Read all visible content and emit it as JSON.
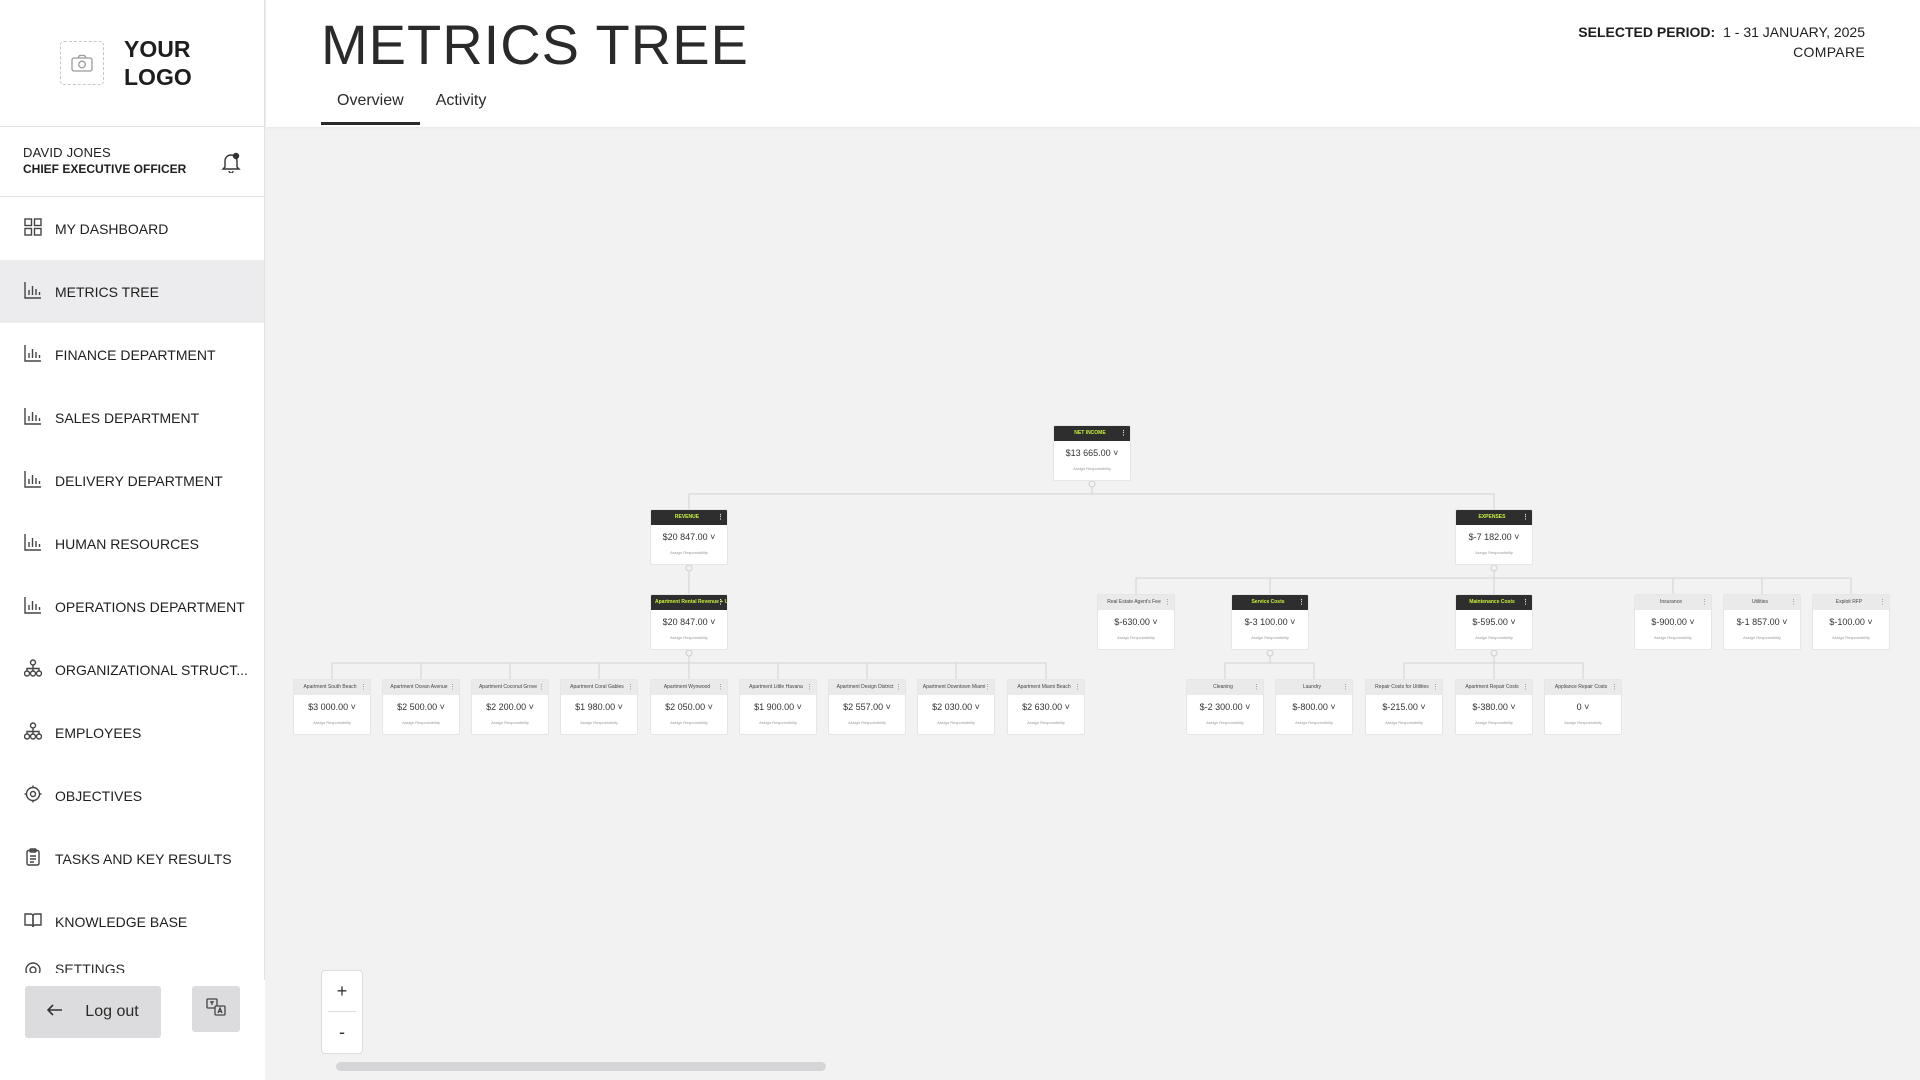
{
  "logo": {
    "text": "YOUR LOGO"
  },
  "user": {
    "name": "DAVID JONES",
    "role": "CHIEF EXECUTIVE OFFICER"
  },
  "nav": [
    {
      "label": "MY DASHBOARD",
      "icon": "grid-icon"
    },
    {
      "label": "METRICS TREE",
      "icon": "bar-chart-icon",
      "active": true
    },
    {
      "label": "FINANCE DEPARTMENT",
      "icon": "bar-chart-icon"
    },
    {
      "label": "SALES DEPARTMENT",
      "icon": "bar-chart-icon"
    },
    {
      "label": "DELIVERY DEPARTMENT",
      "icon": "bar-chart-icon"
    },
    {
      "label": "HUMAN RESOURCES",
      "icon": "bar-chart-icon"
    },
    {
      "label": "OPERATIONS DEPARTMENT",
      "icon": "bar-chart-icon"
    },
    {
      "label": "ORGANIZATIONAL STRUCT...",
      "icon": "org-chart-icon"
    },
    {
      "label": "EMPLOYEES",
      "icon": "org-chart-icon"
    },
    {
      "label": "OBJECTIVES",
      "icon": "target-icon"
    },
    {
      "label": "TASKS AND KEY RESULTS",
      "icon": "clipboard-icon"
    },
    {
      "label": "KNOWLEDGE BASE",
      "icon": "book-icon"
    },
    {
      "label": "SETTINGS",
      "icon": "gear-icon"
    }
  ],
  "logout": {
    "label": "Log out"
  },
  "header": {
    "title": "METRICS TREE",
    "tabs": [
      "Overview",
      "Activity"
    ],
    "period_label": "SELECTED PERIOD:",
    "period_value": "1 - 31 JANUARY, 2025",
    "compare": "COMPARE"
  },
  "zoom": {
    "in": "+",
    "out": "-"
  },
  "tree": {
    "subtitle": "Assign Responsibility",
    "nodes": [
      {
        "title": "NET INCOME",
        "value": "$13 665.00",
        "dark": true
      },
      {
        "title": "REVENUE",
        "value": "$20 847.00",
        "dark": true
      },
      {
        "title": "EXPENSES",
        "value": "$-7 182.00",
        "dark": true
      },
      {
        "title": "Apartment Rental Revenue + Utilitie...",
        "value": "$20 847.00",
        "dark": true
      },
      {
        "title": "Real Estate Agent's Fee",
        "value": "$-630.00"
      },
      {
        "title": "Service Costs",
        "value": "$-3 100.00",
        "dark": true
      },
      {
        "title": "Maintenance Costs",
        "value": "$-595.00",
        "dark": true
      },
      {
        "title": "Insurance",
        "value": "$-900.00"
      },
      {
        "title": "Utilities",
        "value": "$-1 857.00"
      },
      {
        "title": "Exploit RFP",
        "value": "$-100.00"
      },
      {
        "title": "Apartment South Beach",
        "value": "$3 000.00"
      },
      {
        "title": "Apartment Ocean Avenue",
        "value": "$2 500.00"
      },
      {
        "title": "Apartment Coconut Grove",
        "value": "$2 200.00"
      },
      {
        "title": "Apartment Coral Gables",
        "value": "$1 980.00"
      },
      {
        "title": "Apartment Wynwood",
        "value": "$2 050.00"
      },
      {
        "title": "Apartment Little Havana",
        "value": "$1 900.00"
      },
      {
        "title": "Apartment Design District",
        "value": "$2 557.00"
      },
      {
        "title": "Apartment Downtown Miami",
        "value": "$2 030.00"
      },
      {
        "title": "Apartment Miami Beach",
        "value": "$2 630.00"
      },
      {
        "title": "Cleaning",
        "value": "$-2 300.00"
      },
      {
        "title": "Laundry",
        "value": "$-800.00"
      },
      {
        "title": "Repair Costs for Utilities",
        "value": "$-215.00"
      },
      {
        "title": "Apartment Repair Costs",
        "value": "$-380.00"
      },
      {
        "title": "Appliance Repair Costs",
        "value": "0"
      }
    ]
  },
  "colors": {
    "accent": "#c8f23b",
    "dark_header": "#2e2e2e",
    "active_nav": "#ececee"
  }
}
